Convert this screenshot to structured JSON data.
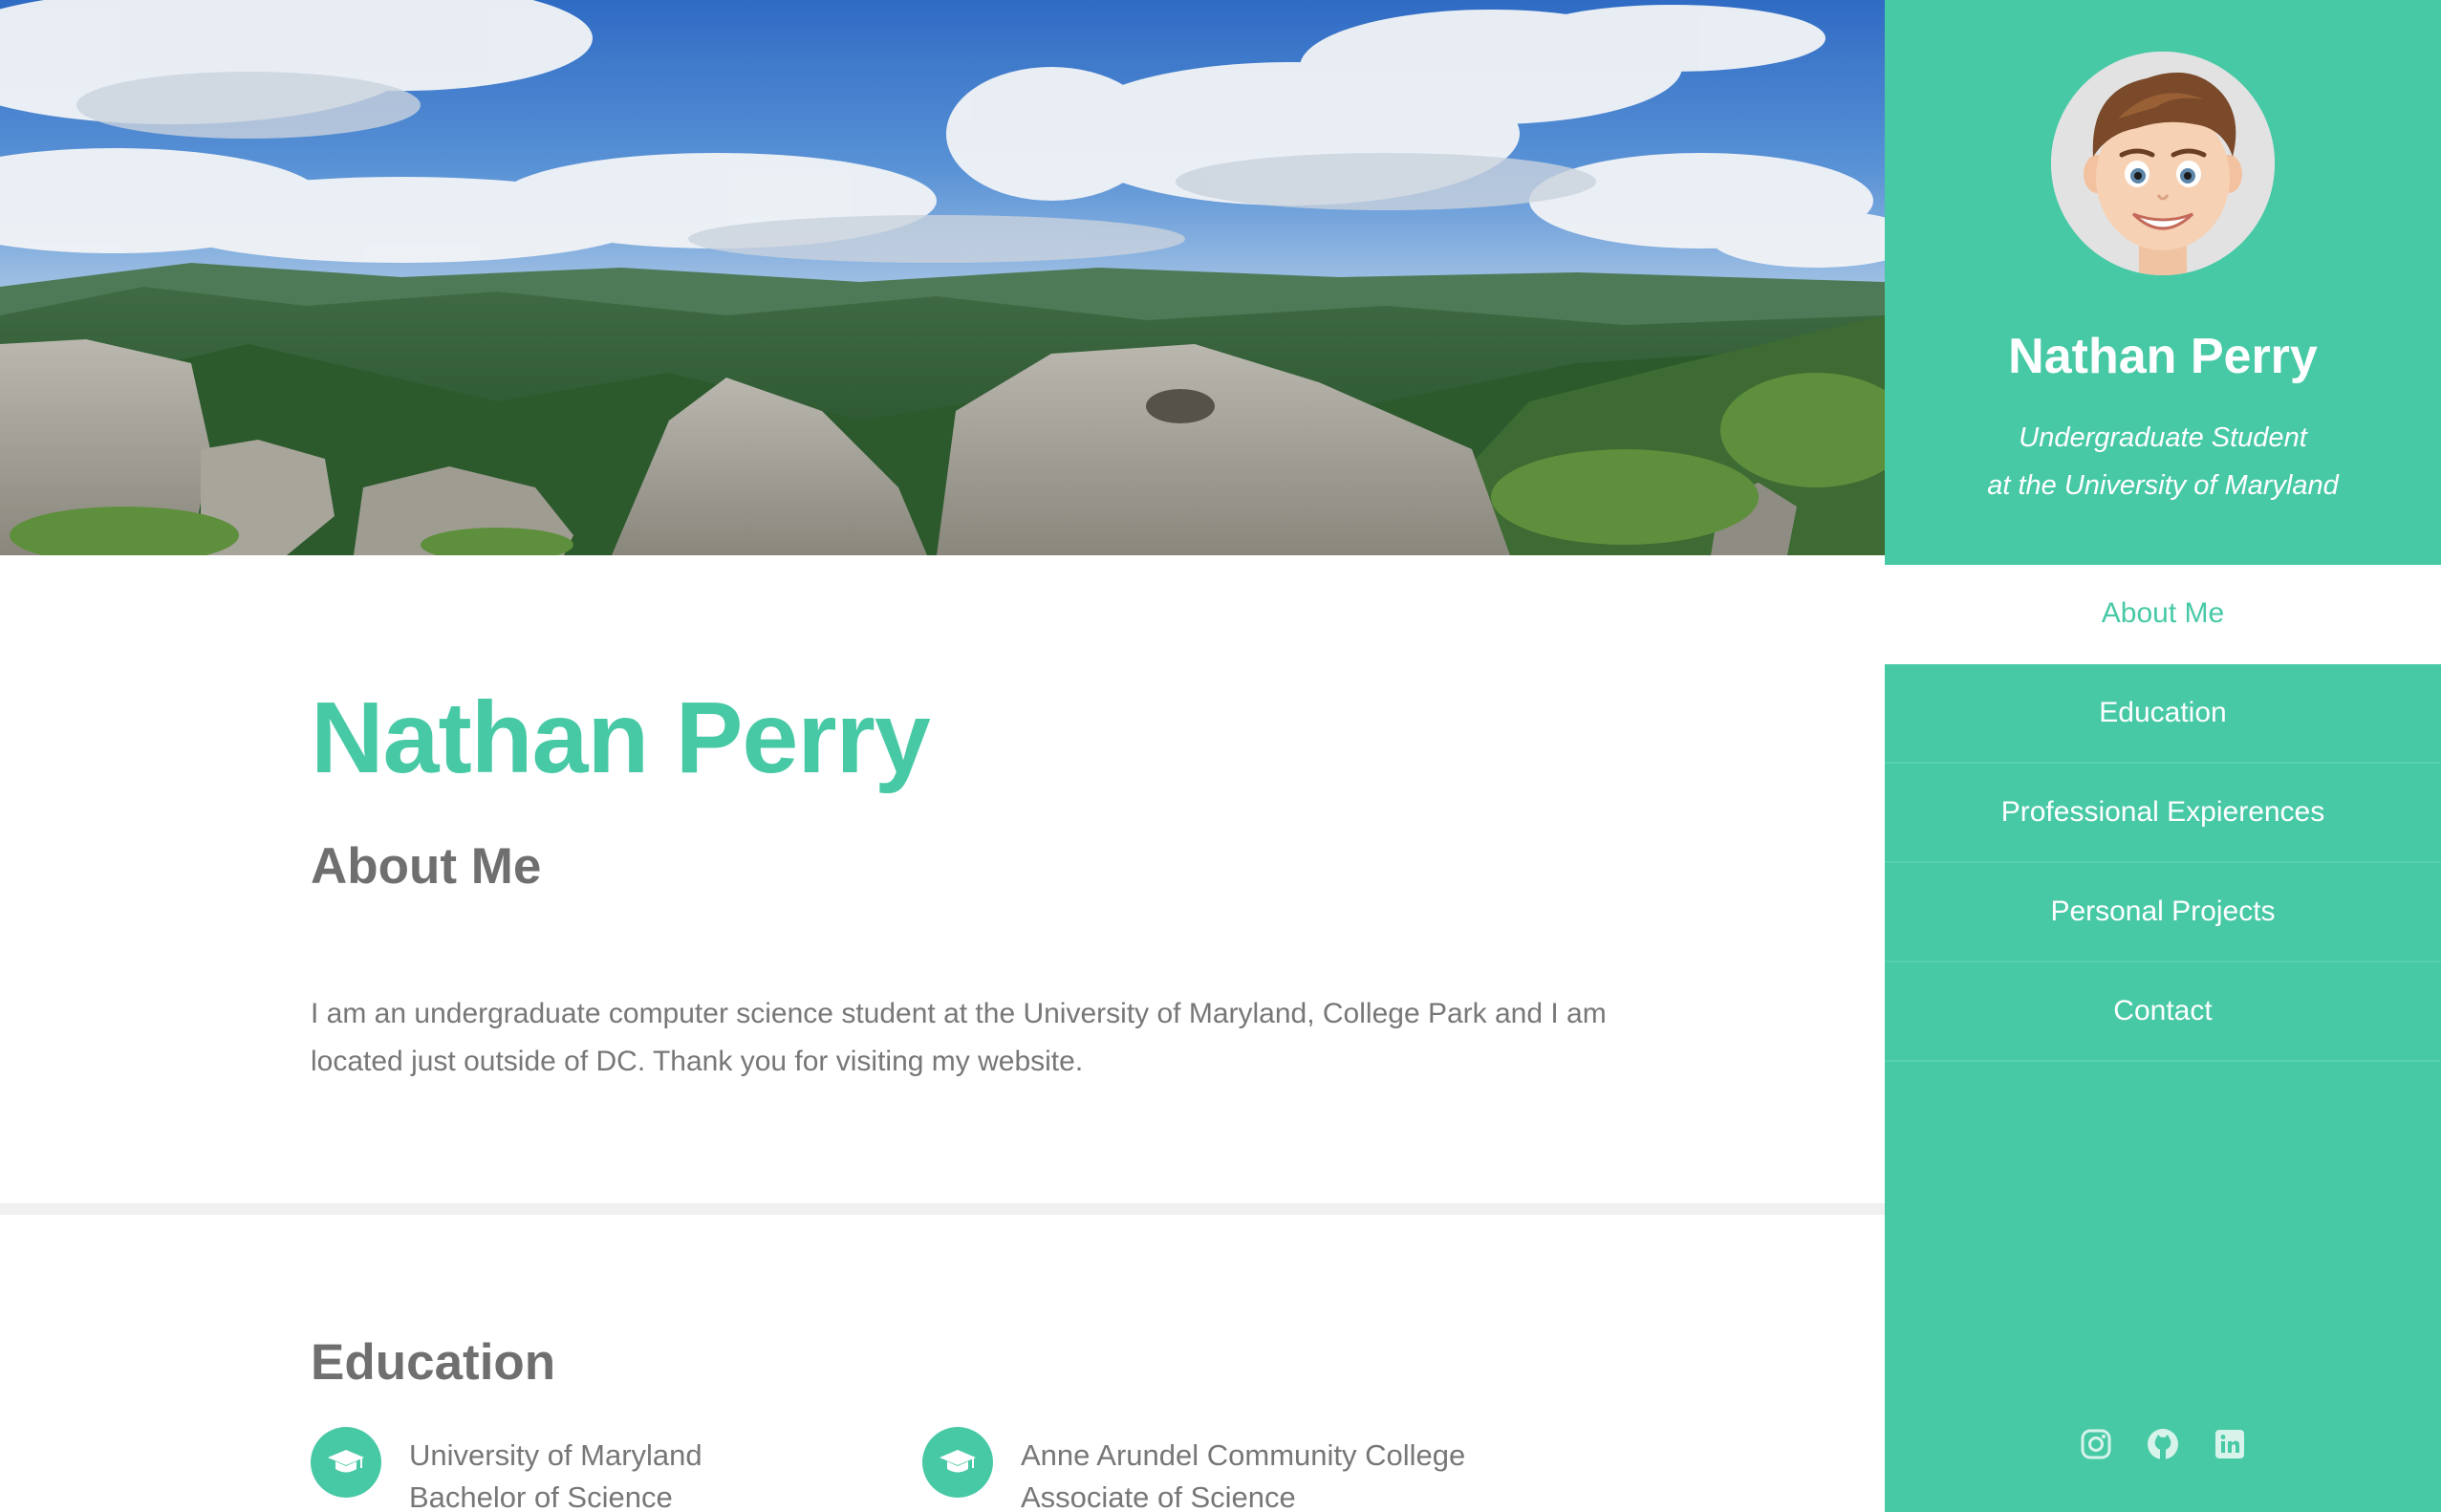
{
  "sidebar": {
    "name": "Nathan Perry",
    "subtitle_line1": "Undergraduate Student",
    "subtitle_line2": "at the University of Maryland",
    "nav": [
      {
        "label": "About Me",
        "active": true
      },
      {
        "label": "Education",
        "active": false
      },
      {
        "label": "Professional Expierences",
        "active": false
      },
      {
        "label": "Personal Projects",
        "active": false
      },
      {
        "label": "Contact",
        "active": false
      }
    ],
    "social_icons": [
      "instagram-icon",
      "github-icon",
      "linkedin-icon"
    ]
  },
  "about": {
    "name": "Nathan Perry",
    "heading": "About Me",
    "text": "I am an undergraduate computer science student at the University of Maryland, College Park and I am located just outside of DC. Thank you for visiting my website."
  },
  "education": {
    "heading": "Education",
    "items": [
      {
        "school": "University of Maryland",
        "degree": "Bachelor of Science",
        "icon": "graduation-cap-icon"
      },
      {
        "school": "Anne Arundel Community College",
        "degree": "Associate of Science",
        "icon": "graduation-cap-icon"
      }
    ]
  },
  "colors": {
    "accent": "#48c9a6",
    "text_gray": "#777777",
    "heading_gray": "#6f6f6f"
  }
}
